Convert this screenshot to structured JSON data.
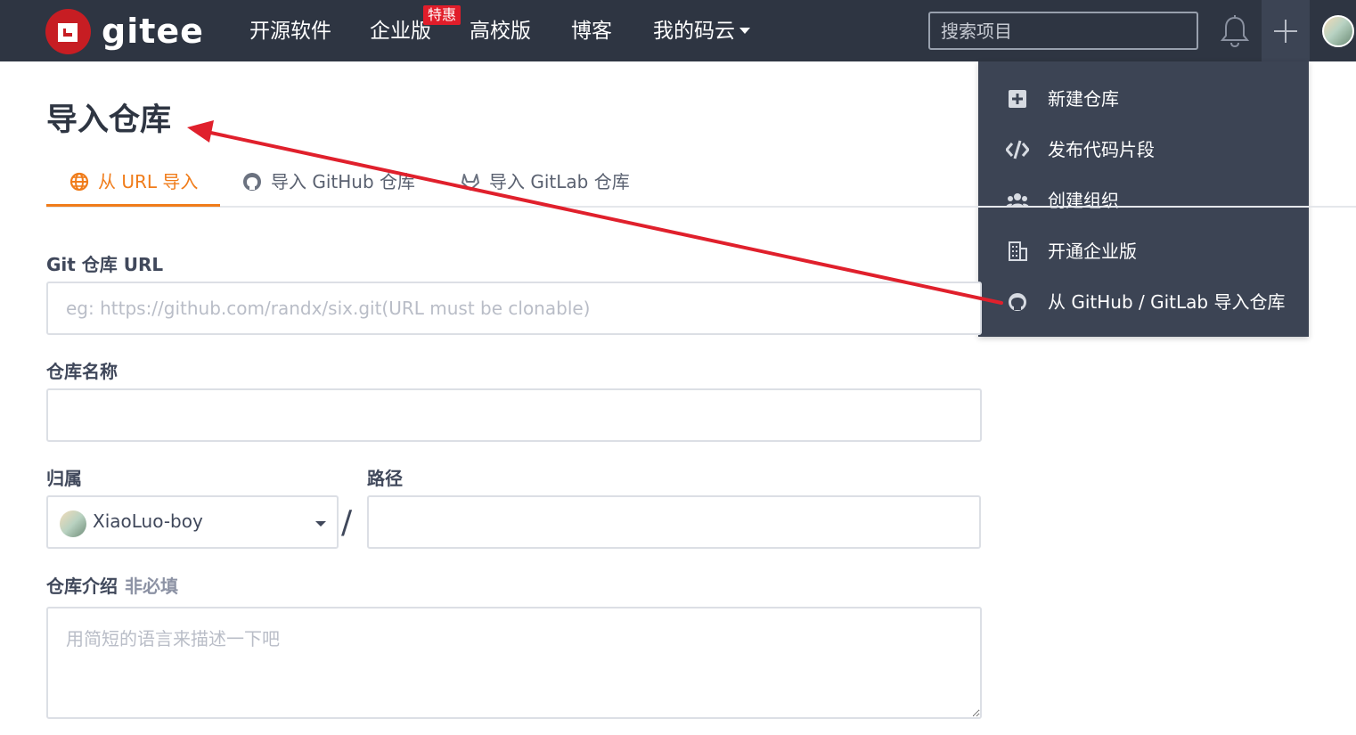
{
  "header": {
    "logo_text": "gitee",
    "nav": {
      "open_source": "开源软件",
      "enterprise": "企业版",
      "enterprise_badge": "特惠",
      "school": "高校版",
      "blog": "博客",
      "my_gitee": "我的码云"
    },
    "search_placeholder": "搜索项目"
  },
  "dropdown": {
    "items": [
      {
        "label": "新建仓库",
        "icon": "plus-square-icon"
      },
      {
        "label": "发布代码片段",
        "icon": "code-icon"
      },
      {
        "label": "创建组织",
        "icon": "users-icon"
      },
      {
        "label": "开通企业版",
        "icon": "building-icon"
      },
      {
        "label": "从 GitHub / GitLab 导入仓库",
        "icon": "github-icon"
      }
    ]
  },
  "main": {
    "title": "导入仓库",
    "tabs": [
      {
        "label": "从 URL 导入",
        "icon": "globe-icon",
        "active": true
      },
      {
        "label": "导入 GitHub 仓库",
        "icon": "github-icon",
        "active": false
      },
      {
        "label": "导入 GitLab 仓库",
        "icon": "gitlab-icon",
        "active": false
      }
    ],
    "form": {
      "git_url_label": "Git 仓库 URL",
      "git_url_placeholder": "eg: https://github.com/randx/six.git(URL must be clonable)",
      "repo_name_label": "仓库名称",
      "owner_label": "归属",
      "owner_value": "XiaoLuo-boy",
      "path_label": "路径",
      "separator": "/",
      "desc_label": "仓库介绍",
      "desc_optional": "非必填",
      "desc_placeholder": "用简短的语言来描述一下吧"
    }
  },
  "colors": {
    "header_bg": "#2e3542",
    "dropdown_bg": "#3c4454",
    "brand_red": "#c71d23",
    "active_tab": "#f07c1a",
    "annotation_arrow": "#e0202c"
  }
}
